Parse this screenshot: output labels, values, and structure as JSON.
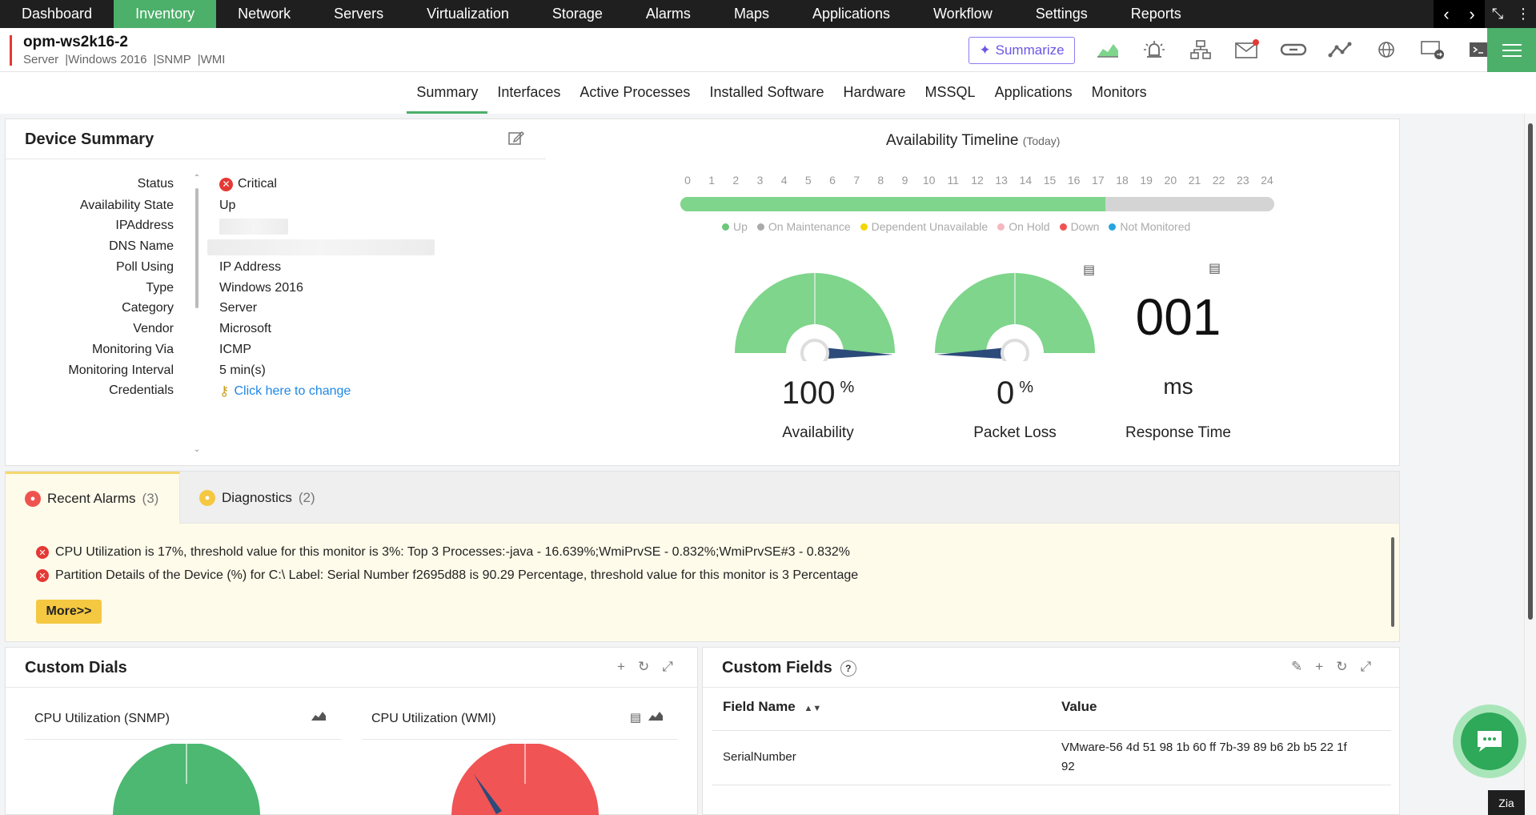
{
  "topnav": {
    "items": [
      "Dashboard",
      "Inventory",
      "Network",
      "Servers",
      "Virtualization",
      "Storage",
      "Alarms",
      "Maps",
      "Applications",
      "Workflow",
      "Settings",
      "Reports"
    ],
    "active": "Inventory"
  },
  "device": {
    "name": "opm-ws2k16-2",
    "meta": [
      "Server",
      "|Windows 2016",
      "|SNMP",
      "|WMI"
    ],
    "summarize_label": "Summarize"
  },
  "tabs": [
    "Summary",
    "Interfaces",
    "Active Processes",
    "Installed Software",
    "Hardware",
    "MSSQL",
    "Applications",
    "Monitors"
  ],
  "device_summary": {
    "title": "Device Summary",
    "rows": [
      {
        "key": "Status",
        "value": "Critical"
      },
      {
        "key": "Availability State",
        "value": "Up"
      },
      {
        "key": "IPAddress",
        "value": ""
      },
      {
        "key": "DNS Name",
        "value": ""
      },
      {
        "key": "Poll Using",
        "value": "IP Address"
      },
      {
        "key": "Type",
        "value": "Windows 2016"
      },
      {
        "key": "Category",
        "value": "Server"
      },
      {
        "key": "Vendor",
        "value": "Microsoft"
      },
      {
        "key": "Monitoring Via",
        "value": "ICMP"
      },
      {
        "key": "Monitoring Interval",
        "value": "5 min(s)"
      },
      {
        "key": "Credentials",
        "value": "Click here to change"
      }
    ]
  },
  "availability": {
    "title": "Availability Timeline",
    "subtitle": "(Today)",
    "hours": [
      "0",
      "1",
      "2",
      "3",
      "4",
      "5",
      "6",
      "7",
      "8",
      "9",
      "10",
      "11",
      "12",
      "13",
      "14",
      "15",
      "16",
      "17",
      "18",
      "19",
      "20",
      "21",
      "22",
      "23",
      "24"
    ],
    "up_fraction": 0.716,
    "legend": [
      {
        "label": "Up",
        "color": "#6cc77a"
      },
      {
        "label": "On Maintenance",
        "color": "#aaaaaa"
      },
      {
        "label": "Dependent Unavailable",
        "color": "#f2d600"
      },
      {
        "label": "On Hold",
        "color": "#f5b7c0"
      },
      {
        "label": "Down",
        "color": "#ef5350"
      },
      {
        "label": "Not Monitored",
        "color": "#29a3e0"
      }
    ],
    "gauges": [
      {
        "value": "100",
        "unit": "%",
        "label": "Availability",
        "level": 100
      },
      {
        "value": "0",
        "unit": "%",
        "label": "Packet Loss",
        "level": 0
      }
    ],
    "response": {
      "value": "001",
      "unit": "ms",
      "label": "Response Time"
    }
  },
  "alarms": {
    "tabs": [
      {
        "label": "Recent Alarms",
        "count": "(3)"
      },
      {
        "label": "Diagnostics",
        "count": "(2)"
      }
    ],
    "messages": [
      "CPU Utilization is 17%, threshold value for this monitor is 3%: Top 3 Processes:-java - 16.639%;WmiPrvSE - 0.832%;WmiPrvSE#3 - 0.832%",
      "Partition Details of the Device (%) for C:\\ Label: Serial Number f2695d88 is 90.29 Percentage, threshold value for this monitor is 3 Percentage"
    ],
    "more_label": "More>>"
  },
  "custom_dials": {
    "title": "Custom Dials",
    "dials": [
      {
        "title": "CPU Utilization (SNMP)",
        "color": "#4cb872"
      },
      {
        "title": "CPU Utilization (WMI)",
        "color": "#f05454"
      }
    ]
  },
  "custom_fields": {
    "title": "Custom Fields",
    "help": "?",
    "col_name": "Field Name",
    "col_value": "Value",
    "rows": [
      {
        "name": "SerialNumber",
        "value_line1": "VMware-56 4d 51 98 1b 60 ff 7b-39 89 b6 2b b5 22 1f",
        "value_line2": "92"
      }
    ]
  },
  "zoho_badge": "Zia"
}
